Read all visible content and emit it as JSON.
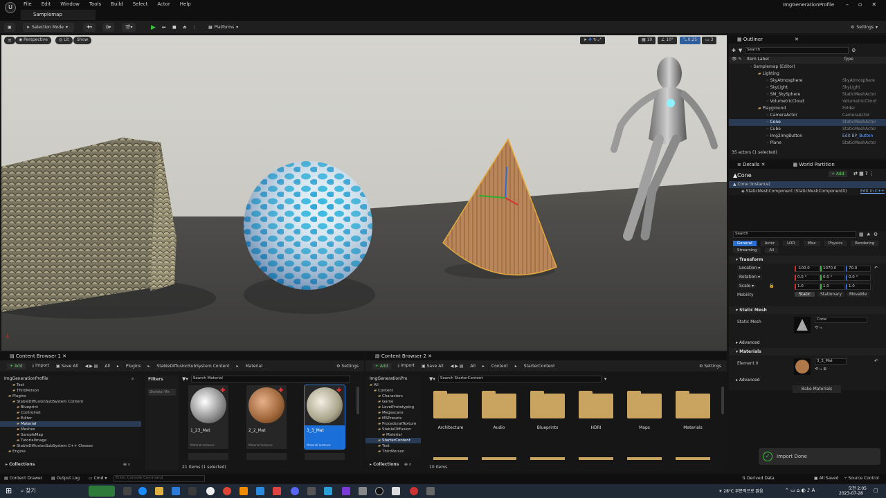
{
  "app": {
    "map_tab": "Samplemap",
    "project": "ImgGenerationProfile",
    "menus": [
      "File",
      "Edit",
      "Window",
      "Tools",
      "Build",
      "Select",
      "Actor",
      "Help"
    ]
  },
  "toolbar": {
    "selection_mode": "Selection Mode",
    "platforms": "Platforms",
    "settings": "Settings"
  },
  "viewport": {
    "perspective": "Perspective",
    "lit": "Lit",
    "show": "Show",
    "grid_snap": "10",
    "rot_snap": "10°",
    "scale_snap": "0.25",
    "cam_speed": "3"
  },
  "outliner": {
    "title": "Outliner",
    "search_placeholder": "Search",
    "col_label": "Item Label",
    "col_type": "Type",
    "rows": [
      {
        "label": "Samplemap (Editor)",
        "type": ""
      },
      {
        "label": "Lighting",
        "type": ""
      },
      {
        "label": "SkyAtmosphere",
        "type": "SkyAtmosphere"
      },
      {
        "label": "SkyLight",
        "type": "SkyLight"
      },
      {
        "label": "SM_SkySphere",
        "type": "StaticMeshActor"
      },
      {
        "label": "VolumetricCloud",
        "type": "VolumetricCloud"
      },
      {
        "label": "Playground",
        "type": "Folder"
      },
      {
        "label": "CameraActor",
        "type": "CameraActor"
      },
      {
        "label": "Cone",
        "type": "StaticMeshActor"
      },
      {
        "label": "Cube",
        "type": "StaticMeshActor"
      },
      {
        "label": "Img2ImgButton",
        "type": "Edit BP_Button"
      },
      {
        "label": "Plane",
        "type": "StaticMeshActor"
      }
    ],
    "count": "35 actors (1 selected)"
  },
  "details": {
    "tab": "Details",
    "tab2": "World Partition",
    "object": "Cone",
    "add": "+ Add",
    "instance": "Cone (Instance)",
    "component": "StaticMeshComponent (StaticMeshComponent0)",
    "edit_cpp": "Edit in C++",
    "search_placeholder": "Search",
    "filters": [
      "General",
      "Actor",
      "LOD",
      "Misc",
      "Physics",
      "Rendering",
      "Streaming",
      "All"
    ],
    "transform": "Transform",
    "location": "Location",
    "rotation": "Rotation",
    "scale": "Scale",
    "mobility": "Mobility",
    "loc": [
      "-100.0",
      "1070.0",
      "70.0"
    ],
    "rot": [
      "0.0 °",
      "0.0 °",
      "0.0 °"
    ],
    "scl": [
      "1.0",
      "1.0",
      "1.0"
    ],
    "mobility_opts": [
      "Static",
      "Stationary",
      "Movable"
    ],
    "static_mesh_sec": "Static Mesh",
    "static_mesh_label": "Static Mesh",
    "static_mesh_value": "Cone",
    "advanced": "Advanced",
    "materials": "Materials",
    "element0": "Element 0",
    "material_value": "3_3_Mat",
    "bake": "Bake Materials"
  },
  "notify": "Import Done",
  "cb1": {
    "tab": "Content Browser 1",
    "add": "+ Add",
    "import": "Import",
    "save_all": "Save All",
    "settings": "Settings",
    "path": [
      "All",
      "Plugins",
      "StableDiffusionSubSystem Content",
      "Material"
    ],
    "root": "ImgGenerationProfile",
    "filters": "Filters",
    "filter_chip": "Skeletal Me",
    "search_placeholder": "Search Material",
    "tree": [
      "Test",
      "ThirdPerson",
      "Plugins",
      "StableDiffusionSubSystem Content",
      "Blueprint",
      "Controlnet",
      "Editor",
      "Material",
      "Meshes",
      "SampleMap",
      "TutorialImage",
      "StableDiffusionSubSystem C++ Classes",
      "Engine"
    ],
    "assets": [
      {
        "name": "1_23_Mat",
        "sub": "Material Instance"
      },
      {
        "name": "2_2_Mat",
        "sub": "Material Instance"
      },
      {
        "name": "3_3_Mat",
        "sub": "Material Instance"
      }
    ],
    "count": "21 items (1 selected)",
    "collections": "Collections"
  },
  "cb2": {
    "tab": "Content Browser 2",
    "add": "+ Add",
    "import": "Import",
    "save_all": "Save All",
    "settings": "Settings",
    "path": [
      "All",
      "Content",
      "StarterContent"
    ],
    "root": "ImgGenerationPro",
    "search_placeholder": "Search StarterContent",
    "tree": [
      "All",
      "Content",
      "Characters",
      "Game",
      "LevelPrototyping",
      "Megascans",
      "MSPresets",
      "ProceduralTexture",
      "StableDiffusion",
      "Material",
      "StarterContent",
      "Test",
      "ThirdPerson"
    ],
    "folders": [
      "Architecture",
      "Audio",
      "Blueprints",
      "HDRI",
      "Maps",
      "Materials"
    ],
    "count": "10 items",
    "collections": "Collections"
  },
  "status": {
    "drawer": "Content Drawer",
    "output": "Output Log",
    "cmd": "Cmd",
    "console_placeholder": "Enter Console Command",
    "derived": "Derived Data",
    "saved": "All Saved",
    "source": "Source Control"
  },
  "taskbar": {
    "search": "찾기",
    "weather": "28°C 부분적으로 맑음",
    "time": "오전 2:05",
    "date": "2023-07-28"
  }
}
